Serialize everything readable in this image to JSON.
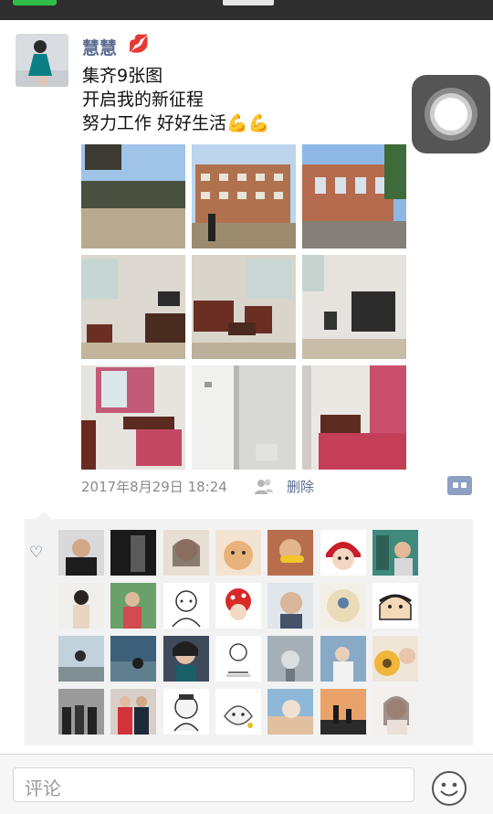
{
  "post": {
    "username": "慧慧",
    "username_emoji": "💋",
    "text_lines": [
      "集齐9张图",
      "开启我的新征程",
      "努力工作  好好生活💪💪"
    ],
    "timestamp": "2017年8月29日 18:24",
    "delete_label": "删除"
  },
  "comment": {
    "placeholder": "评论"
  },
  "icons": {
    "heart": "heart-outline-icon",
    "privacy": "friends-visibility-icon",
    "more": "more-actions-icon",
    "emoji": "emoji-face-icon",
    "assistive_touch": "assistive-touch-icon"
  },
  "colors": {
    "name_link": "#5a6b8f",
    "time_text": "#8a8a8a",
    "likes_bg": "#f2f2f2",
    "topbar": "#2e2e2e"
  }
}
